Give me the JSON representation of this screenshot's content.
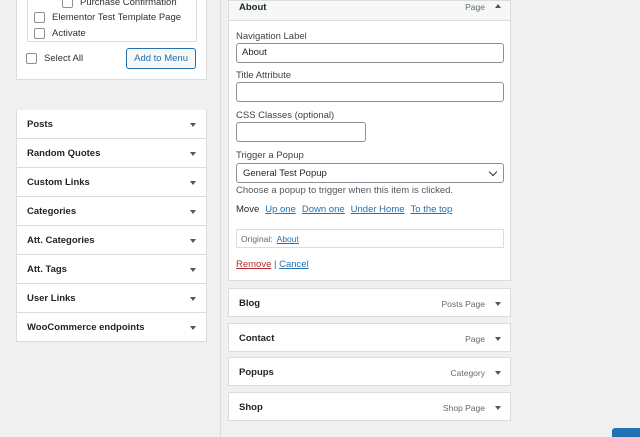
{
  "pages_box": {
    "items": [
      "Purchase Confirmation",
      "Elementor Test Template Page",
      "Activate"
    ],
    "select_all_label": "Select All",
    "add_to_menu_label": "Add to Menu"
  },
  "accordion": [
    "Posts",
    "Random Quotes",
    "Custom Links",
    "Categories",
    "Att. Categories",
    "Att. Tags",
    "User Links",
    "WooCommerce endpoints"
  ],
  "about_item": {
    "title": "About",
    "type": "Page",
    "nav_label_label": "Navigation Label",
    "nav_label_value": "About",
    "title_attr_label": "Title Attribute",
    "title_attr_value": "",
    "css_label": "CSS Classes (optional)",
    "css_value": "",
    "popup_label": "Trigger a Popup",
    "popup_value": "General Test Popup",
    "popup_desc": "Choose a popup to trigger when this item is clicked.",
    "move_label": "Move",
    "move_links": [
      "Up one",
      "Down one",
      "Under Home",
      "To the top"
    ],
    "original_label": "Original:",
    "original_link": "About",
    "remove_label": "Remove",
    "separator": "|",
    "cancel_label": "Cancel"
  },
  "menu_items": [
    {
      "title": "Blog",
      "type": "Posts Page"
    },
    {
      "title": "Contact",
      "type": "Page"
    },
    {
      "title": "Popups",
      "type": "Category"
    },
    {
      "title": "Shop",
      "type": "Shop Page"
    }
  ],
  "colors": {
    "link": "#2271b1",
    "remove": "#b32d2e",
    "border": "#dcdcde",
    "background": "#f0f0f1"
  }
}
